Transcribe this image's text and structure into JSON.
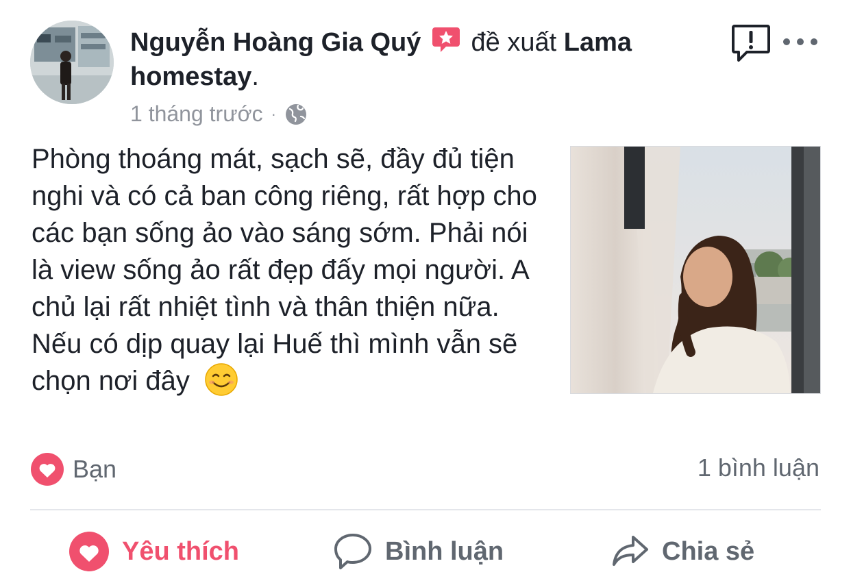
{
  "post": {
    "author": "Nguyễn Hoàng Gia Quý",
    "recommends_text": "đề xuất",
    "page_name": "Lama homestay",
    "period": ".",
    "time": "1 tháng trước",
    "separator": "·",
    "audience_icon": "globe-icon",
    "body_text": "Phòng thoáng mát, sạch sẽ, đầy đủ tiện nghi và có cả ban công riêng, rất hợp cho các bạn sống ảo vào sáng sớm. Phải nói là view sống ảo rất đẹp đấy mọi người. A chủ lại rất nhiệt tình và thân thiện nữa. Nếu có dịp quay lại Huế thì mình vẫn sẽ chọn nơi đây",
    "emoji": "smiling-face-emoji"
  },
  "reactions": {
    "icon": "heart-icon",
    "label": "Bạn",
    "comments_count": "1 bình luận"
  },
  "actions": {
    "like": "Yêu thích",
    "comment": "Bình luận",
    "share": "Chia sẻ"
  },
  "colors": {
    "accent_red": "#f0506e",
    "muted_text": "#606770",
    "meta_text": "#90949c",
    "primary_text": "#1d2129"
  }
}
